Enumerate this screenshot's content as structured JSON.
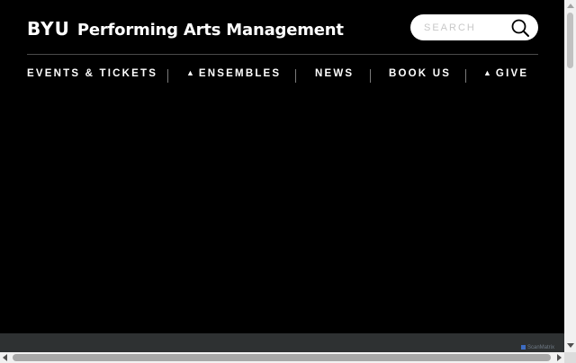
{
  "brand": {
    "byu": "BYU",
    "name": "Performing Arts Management"
  },
  "search": {
    "placeholder": "SEARCH",
    "icon": "search-icon"
  },
  "nav": {
    "items": [
      {
        "label": "EVENTS & TICKETS",
        "has_dropdown": false
      },
      {
        "label": "ENSEMBLES",
        "has_dropdown": true,
        "dropdown_glyph": "▲"
      },
      {
        "label": "NEWS",
        "has_dropdown": false
      },
      {
        "label": "BOOK US",
        "has_dropdown": false
      },
      {
        "label": "GIVE",
        "has_dropdown": true,
        "dropdown_glyph": "▲"
      }
    ]
  },
  "footer": {
    "badge": "ScanMatrix"
  },
  "colors": {
    "background": "#000000",
    "text": "#ffffff",
    "divider": "#4a4a4a",
    "footer_bar": "#2e3132",
    "search_bg": "#ffffff"
  }
}
